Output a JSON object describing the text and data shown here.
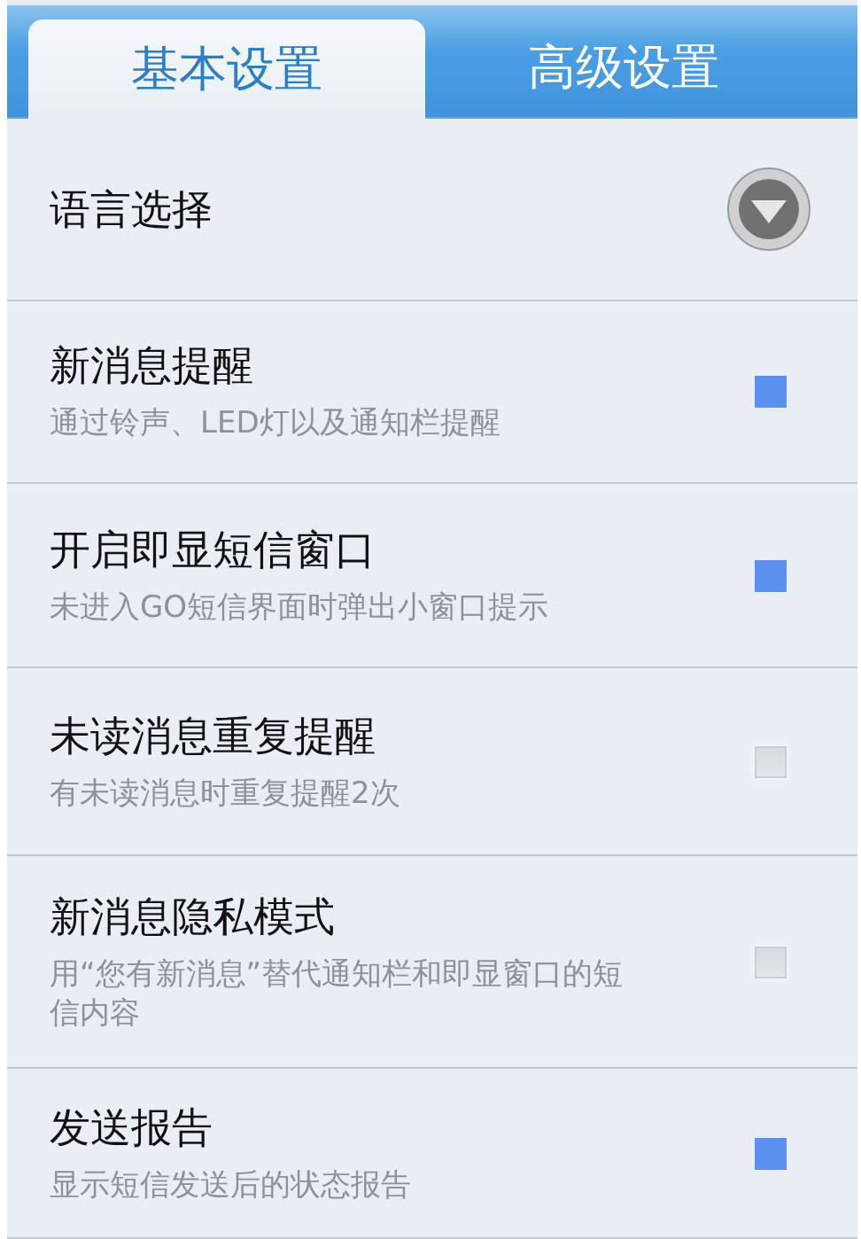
{
  "tabs": [
    {
      "label": "基本设置",
      "selected": true
    },
    {
      "label": "高级设置",
      "selected": false
    }
  ],
  "settings": [
    {
      "kind": "dropdown",
      "title": "语言选择"
    },
    {
      "kind": "checkbox",
      "title": "新消息提醒",
      "summary": "通过铃声、LED灯以及通知栏提醒",
      "checked": true
    },
    {
      "kind": "checkbox",
      "title": "开启即显短信窗口",
      "summary": "未进入GO短信界面时弹出小窗口提示",
      "checked": true
    },
    {
      "kind": "checkbox",
      "title": "未读消息重复提醒",
      "summary": "有未读消息时重复提醒2次",
      "checked": false
    },
    {
      "kind": "checkbox",
      "title": "新消息隐私模式",
      "summary": "用“您有新消息”替代通知栏和即显窗口的短信内容",
      "checked": false
    },
    {
      "kind": "checkbox",
      "title": "发送报告",
      "summary": "显示短信发送后的状态报告",
      "checked": true
    }
  ]
}
